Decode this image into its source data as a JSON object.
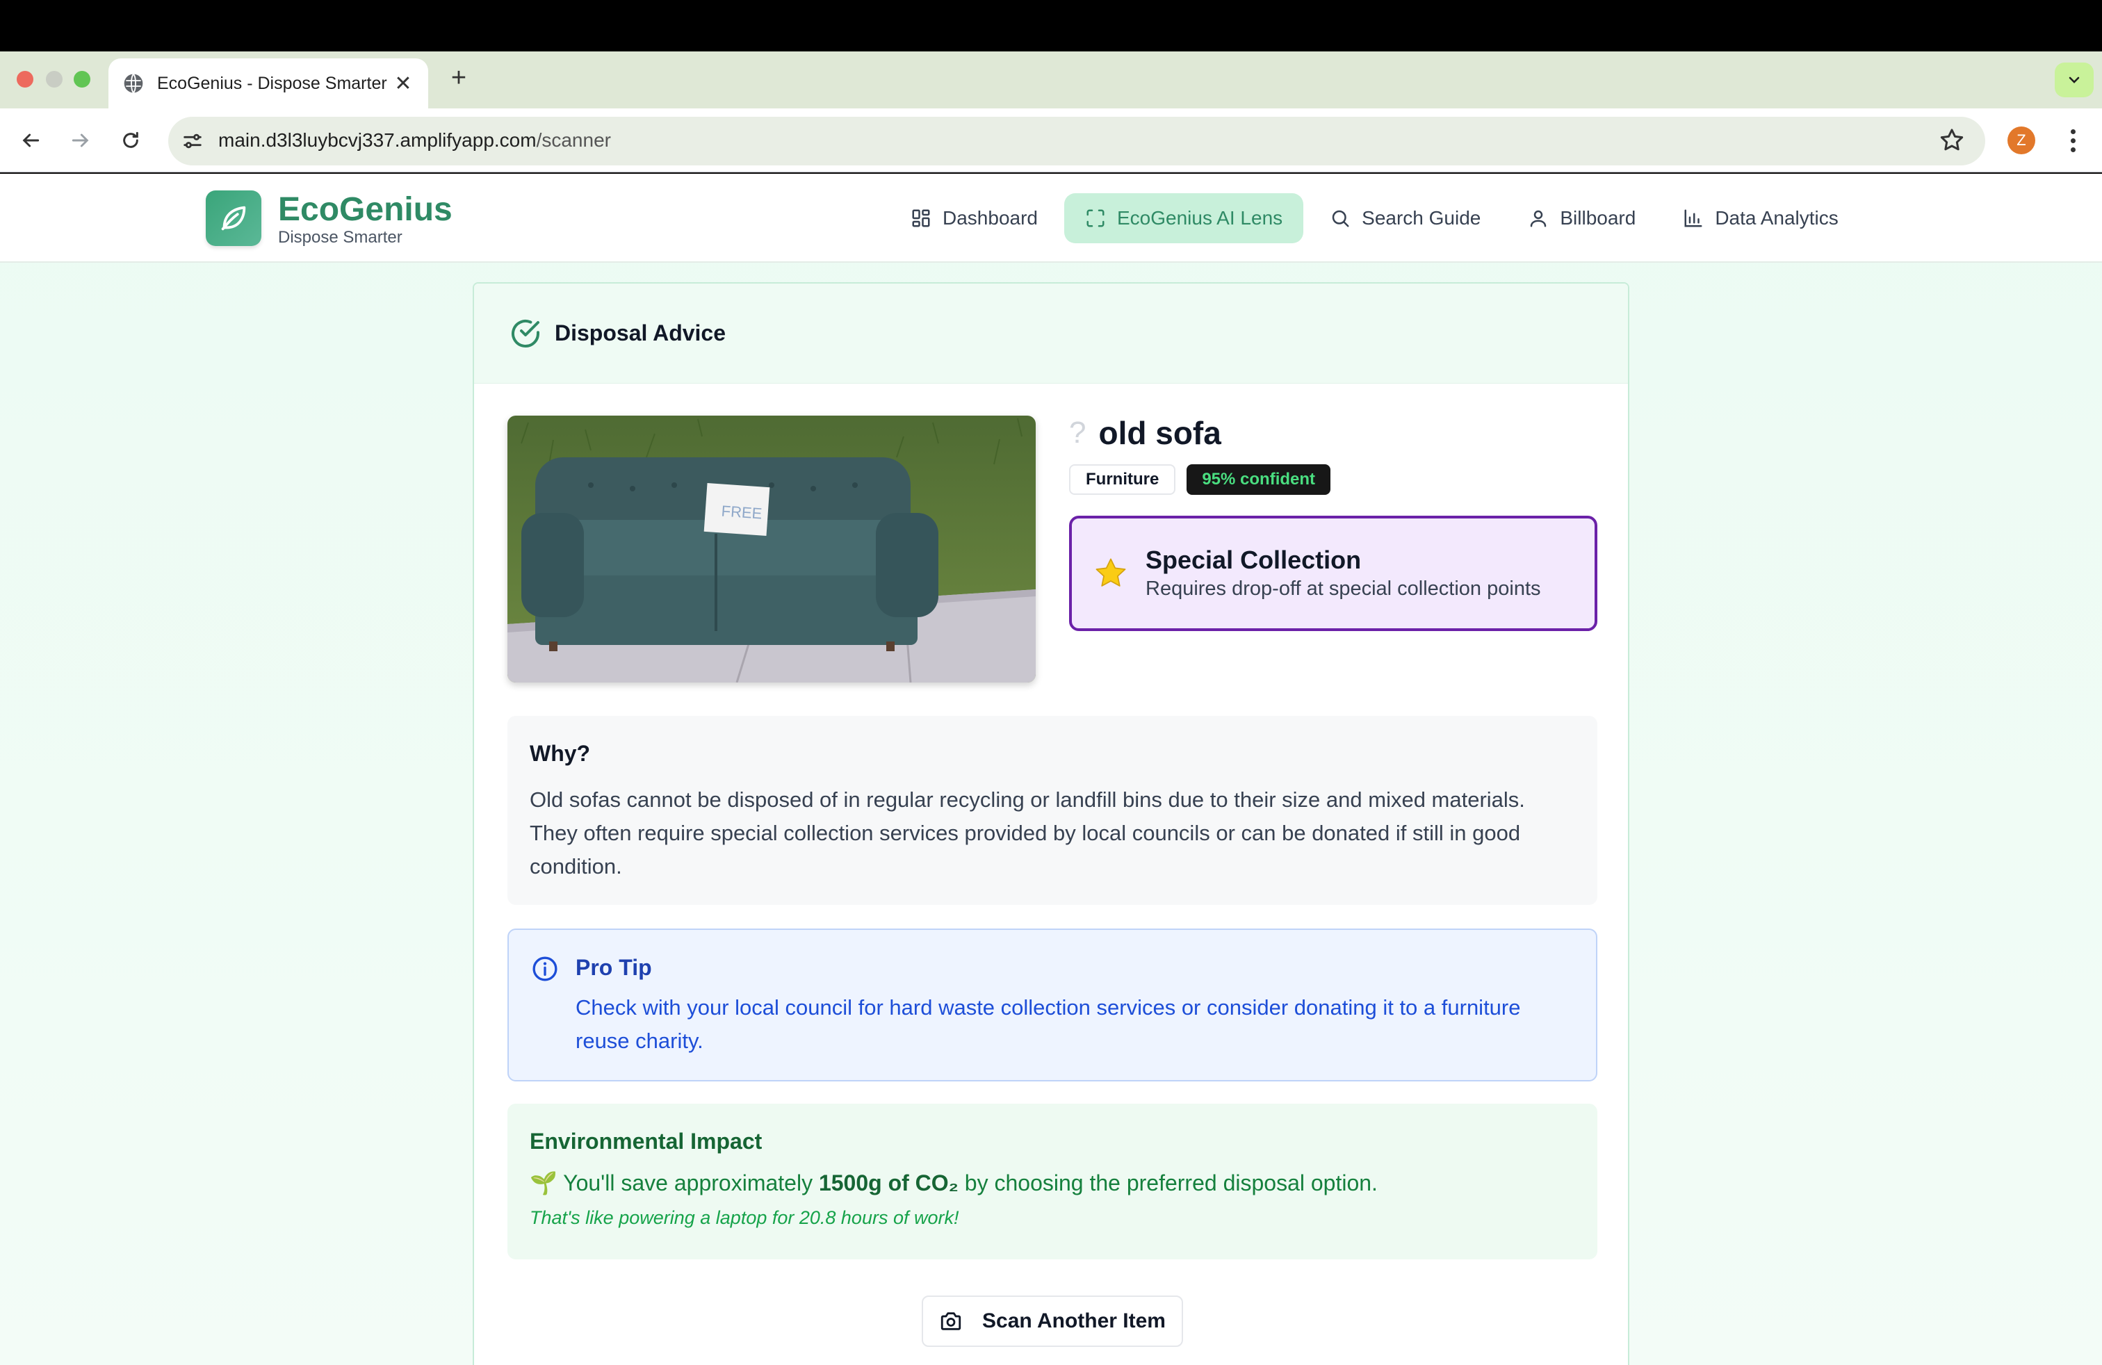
{
  "browser": {
    "tab_title": "EcoGenius - Dispose Smarter",
    "url_host": "main.d3l3luybcvj337.amplifyapp.com",
    "url_path": "/scanner",
    "profile_initial": "Z"
  },
  "app": {
    "brand_name": "EcoGenius",
    "brand_tagline": "Dispose Smarter",
    "nav": [
      {
        "label": "Dashboard",
        "icon": "grid-icon"
      },
      {
        "label": "EcoGenius AI Lens",
        "icon": "scan-frame-icon",
        "active": true
      },
      {
        "label": "Search Guide",
        "icon": "search-icon"
      },
      {
        "label": "Billboard",
        "icon": "user-icon"
      },
      {
        "label": "Data Analytics",
        "icon": "bar-chart-icon"
      }
    ],
    "accent_color": "#2f8a65"
  },
  "advice": {
    "header": "Disposal Advice",
    "item_icon": "?",
    "item_name": "old sofa",
    "category": "Furniture",
    "confidence": "95% confident",
    "method": {
      "title": "Special Collection",
      "description": "Requires drop-off at special collection points",
      "icon": "star-icon"
    },
    "why": {
      "heading": "Why?",
      "text": "Old sofas cannot be disposed of in regular recycling or landfill bins due to their size and mixed materials. They often require special collection services provided by local councils or can be donated if still in good condition."
    },
    "pro_tip": {
      "heading": "Pro Tip",
      "text": "Check with your local council for hard waste collection services or consider donating it to a furniture reuse charity."
    },
    "environment": {
      "heading": "Environmental Impact",
      "prefix": "You'll save approximately",
      "amount": "1500g of CO₂",
      "suffix": "by choosing the preferred disposal option.",
      "comparison": "That's like powering a laptop for 20.8 hours of work!"
    },
    "scan_button": "Scan Another Item",
    "photo_sign": "FREE"
  }
}
